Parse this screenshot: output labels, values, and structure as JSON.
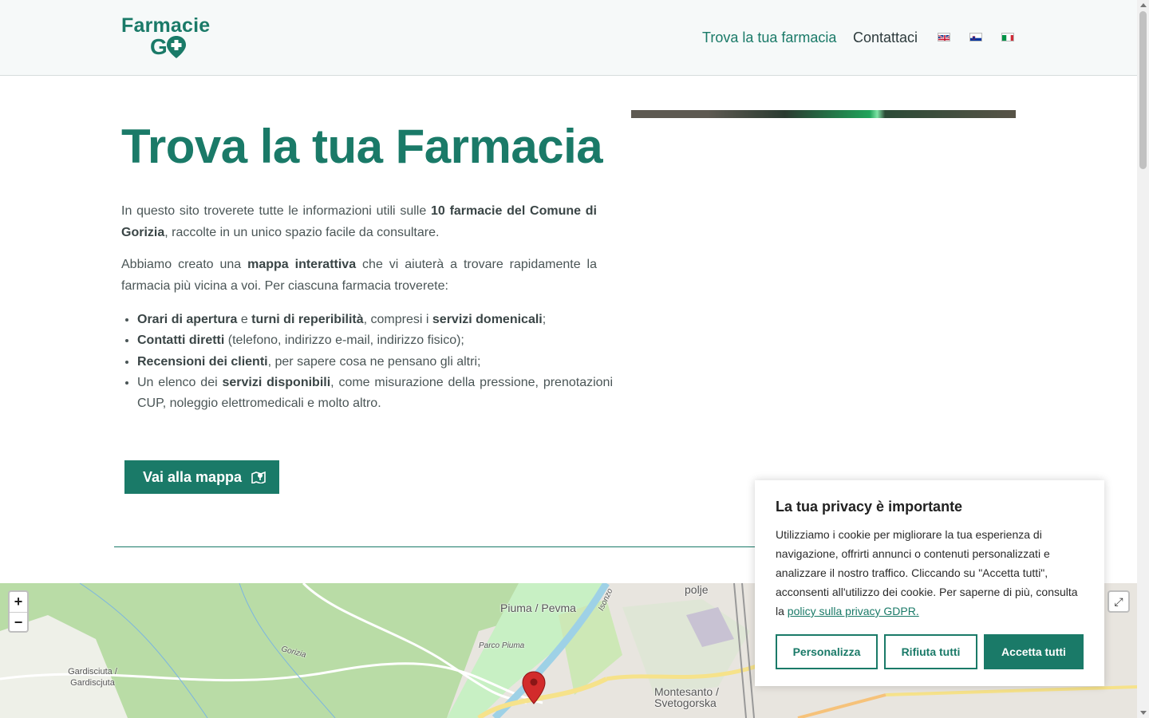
{
  "brand": {
    "line1": "Farmacie",
    "line2": "G",
    "color": "#1a7a68"
  },
  "nav": {
    "items": [
      {
        "label": "Trova la tua farmacia",
        "active": true
      },
      {
        "label": "Contattaci",
        "active": false
      }
    ],
    "languages": [
      "en-flag-icon",
      "sl-flag-icon",
      "it-flag-icon"
    ]
  },
  "hero": {
    "title": "Trova la tua Farmacia",
    "intro": {
      "t1": "In questo sito troverete tutte le informazioni utili sulle ",
      "b1": "10 farmacie del Comune di Gorizia",
      "t2": ", raccolte in un unico spazio facile da consultare."
    },
    "intro2": {
      "t1": "Abbiamo creato una ",
      "b1": "mappa interattiva",
      "t2": " che vi aiuterà a trovare rapidamente la farmacia più vicina a voi. Per ciascuna farmacia troverete:"
    },
    "features": [
      {
        "b1": "Orari di apertura",
        "t1": " e ",
        "b2": "turni di reperibilità",
        "t2": ", compresi i ",
        "b3": "servizi domenicali",
        "t3": ";"
      },
      {
        "b1": "Contatti diretti",
        "t1": " (telefono, indirizzo e-mail, indirizzo fisico);"
      },
      {
        "b1": "Recensioni dei clienti",
        "t1": ", per sapere cosa ne pensano gli altri;"
      },
      {
        "t0": "Un elenco dei ",
        "b1": "servizi disponibili",
        "t1": ", come misurazione della pressione, prenotazioni CUP, noleggio elettromedicali e molto altro."
      }
    ],
    "cta_label": "Vai alla mappa"
  },
  "map": {
    "zoom_in": "+",
    "zoom_out": "−",
    "labels": [
      "Piuma / Pevma",
      "Parco Piuma",
      "Gorizia",
      "Isonzo",
      "Gardisciuta / Gardiscjuta",
      "Montesanto / Svetogorska",
      "polje"
    ],
    "fullscreen_icon": "expand-icon"
  },
  "cookie": {
    "title": "La tua privacy è importante",
    "text": "Utilizziamo i cookie per migliorare la tua esperienza di navigazione, offrirti annunci o contenuti personalizzati e analizzare il nostro traffico. Cliccando su \"Accetta tutti\", acconsenti all'utilizzo dei cookie. Per saperne di più, consulta la ",
    "link": "policy sulla privacy GDPR.",
    "buttons": {
      "customize": "Personalizza",
      "reject": "Rifiuta tutti",
      "accept": "Accetta tutti"
    }
  }
}
